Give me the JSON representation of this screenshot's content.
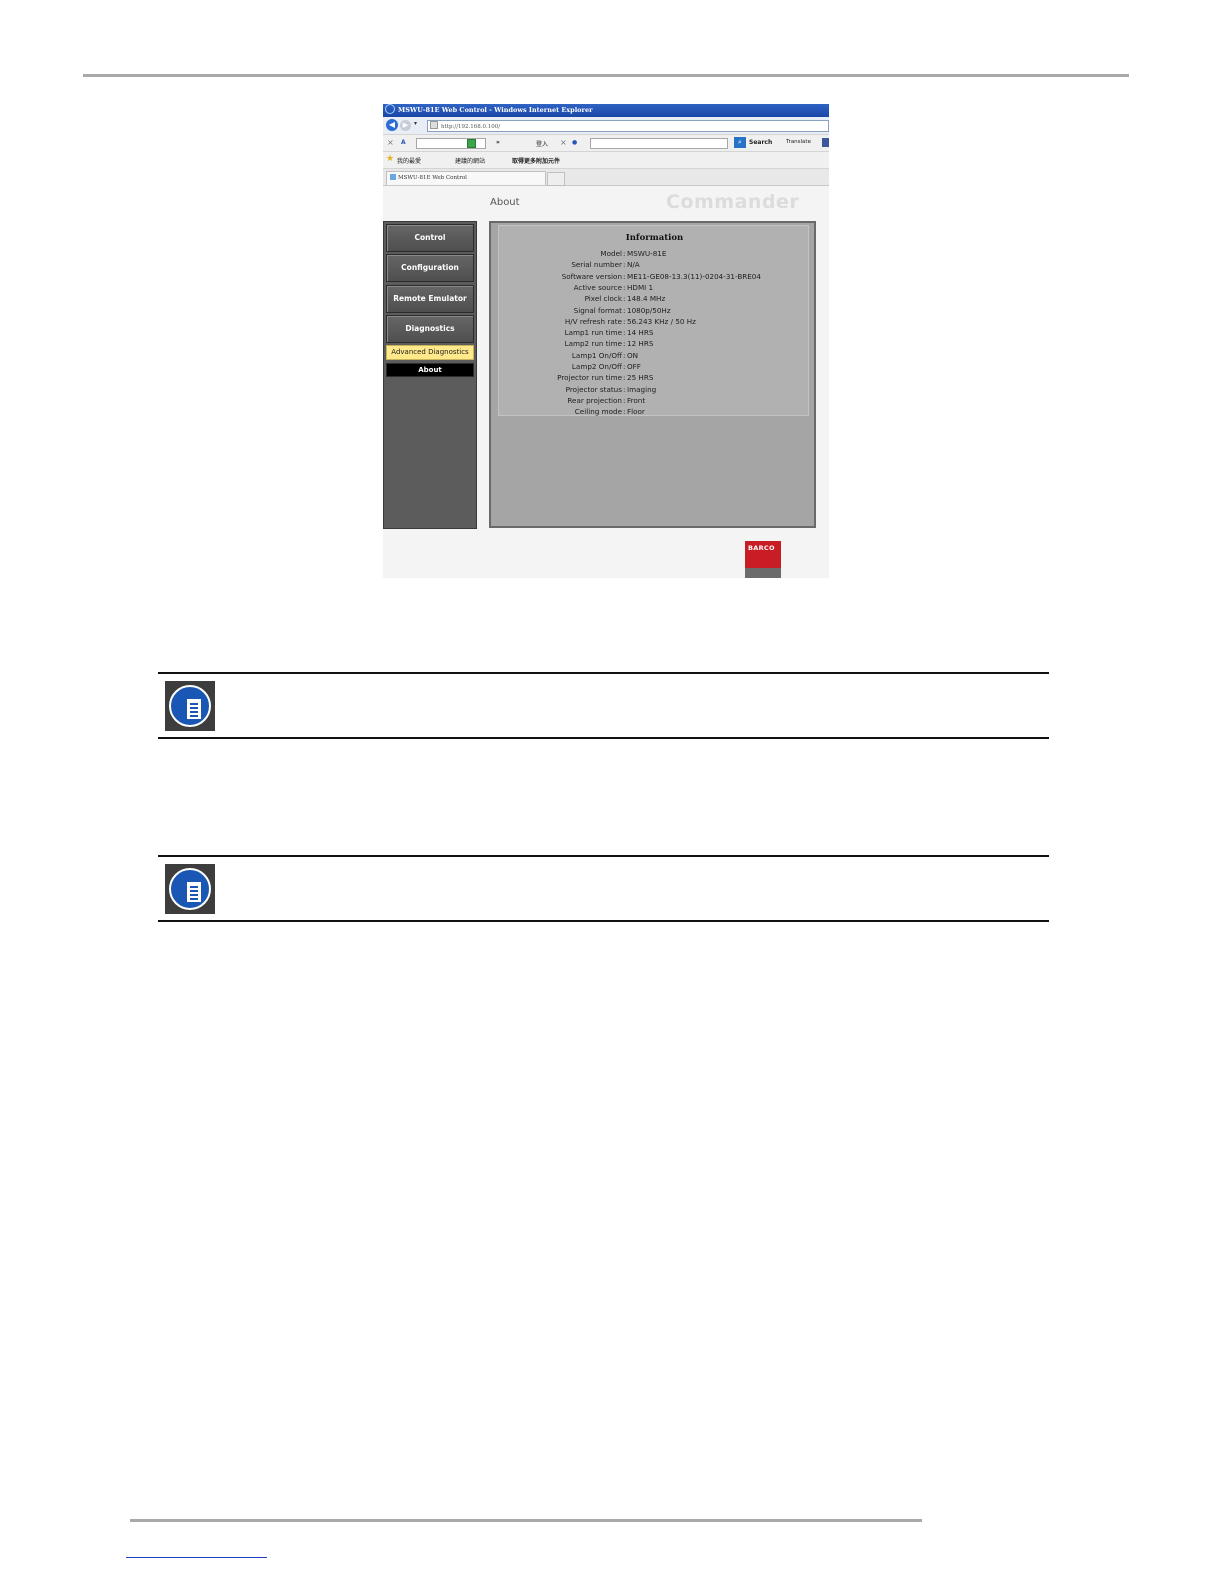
{
  "browser": {
    "window_title": "MSWU-81E Web Control - Windows Internet Explorer",
    "address": "http://192.168.0.100/",
    "toolbar": {
      "login_label": "登入",
      "search_label": "Search",
      "translate_label": "Translate"
    },
    "favorites": {
      "favorites_label": "我的最愛",
      "suggested_sites": "建議的網站",
      "get_more_addons": "取得更多附加元件"
    },
    "tab_title": "MSWU-81E Web Control"
  },
  "app": {
    "page_heading": "About",
    "brand": "Commander",
    "sidebar": [
      {
        "label": "Control"
      },
      {
        "label": "Configuration"
      },
      {
        "label": "Remote Emulator"
      },
      {
        "label": "Diagnostics"
      },
      {
        "label": "Advanced Diagnostics"
      },
      {
        "label": "About"
      }
    ],
    "info": {
      "title": "Information",
      "rows": [
        {
          "label": "Model",
          "value": "MSWU-81E"
        },
        {
          "label": "Serial number",
          "value": "N/A"
        },
        {
          "label": "Software version",
          "value": "ME11-GE08-13.3(11)-0204-31-BRE04"
        },
        {
          "label": "Active source",
          "value": "HDMI 1"
        },
        {
          "label": "Pixel clock",
          "value": "148.4 MHz"
        },
        {
          "label": "Signal format",
          "value": "1080p/50Hz"
        },
        {
          "label": "H/V refresh rate",
          "value": "56.243 KHz     / 50 Hz"
        },
        {
          "label": "Lamp1 run time",
          "value": "14 HRS"
        },
        {
          "label": "Lamp2 run time",
          "value": "12 HRS"
        },
        {
          "label": "Lamp1 On/Off",
          "value": "ON"
        },
        {
          "label": "Lamp2 On/Off",
          "value": "OFF"
        },
        {
          "label": "Projector run time",
          "value": "25 HRS"
        },
        {
          "label": "Projector status",
          "value": "Imaging"
        },
        {
          "label": "Rear projection",
          "value": "Front"
        },
        {
          "label": "Ceiling mode",
          "value": "Floor"
        }
      ]
    },
    "logo_text": "BARCO"
  },
  "colors": {
    "accent_blue": "#1a57b5",
    "highlight_yellow": "#ffe98a",
    "barco_red": "#c81d25"
  },
  "icons": [
    "back-arrow-icon",
    "forward-arrow-icon",
    "search-icon",
    "favorites-star-icon",
    "note-document-icon"
  ]
}
